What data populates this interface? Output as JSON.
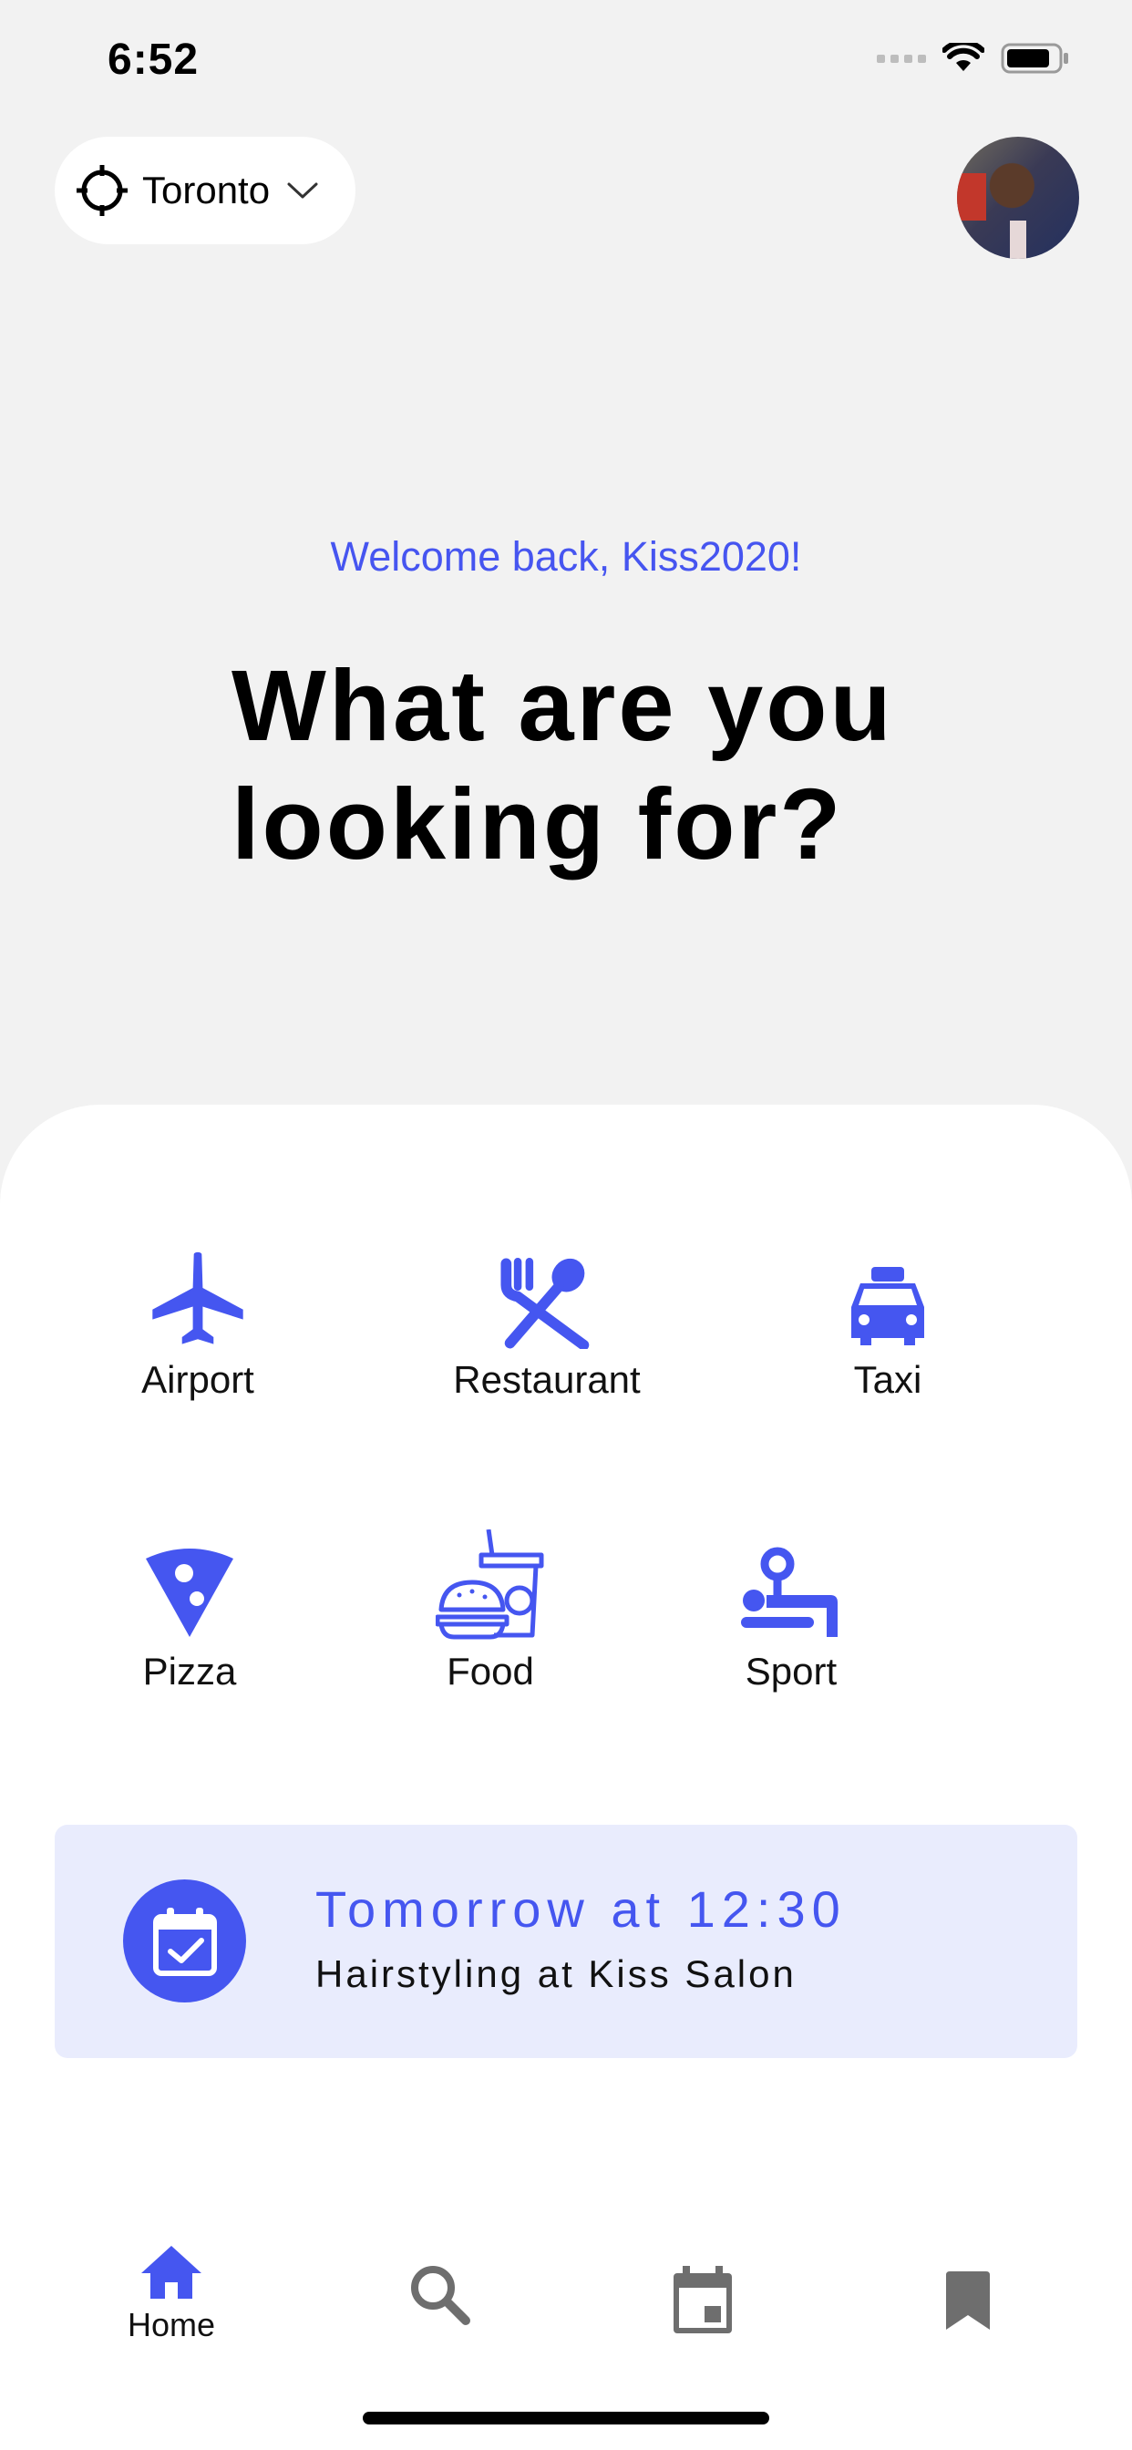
{
  "status_bar": {
    "time": "6:52"
  },
  "header": {
    "location": "Toronto"
  },
  "hero": {
    "welcome": "Welcome back, Kiss2020!",
    "headline_line1": "What are you",
    "headline_line2": "looking for?"
  },
  "categories": [
    {
      "label": "Airport",
      "icon": "airplane-icon"
    },
    {
      "label": "Restaurant",
      "icon": "fork-spoon-icon"
    },
    {
      "label": "Taxi",
      "icon": "taxi-icon"
    },
    {
      "label": "Pizza",
      "icon": "pizza-icon"
    },
    {
      "label": "Food",
      "icon": "burger-drink-icon"
    },
    {
      "label": "Sport",
      "icon": "exercise-icon"
    }
  ],
  "appointment": {
    "time": "Tomorrow at 12:30",
    "description": "Hairstyling at Kiss Salon",
    "icon": "calendar-check-icon"
  },
  "bottom_nav": {
    "home_label": "Home",
    "items": [
      "home-icon",
      "search-icon",
      "calendar-icon",
      "bookmark-icon"
    ]
  },
  "colors": {
    "accent": "#4556f0",
    "background": "#f2f2f2",
    "card": "#e9ecfd",
    "inactive_icon": "#6e6e6e"
  }
}
